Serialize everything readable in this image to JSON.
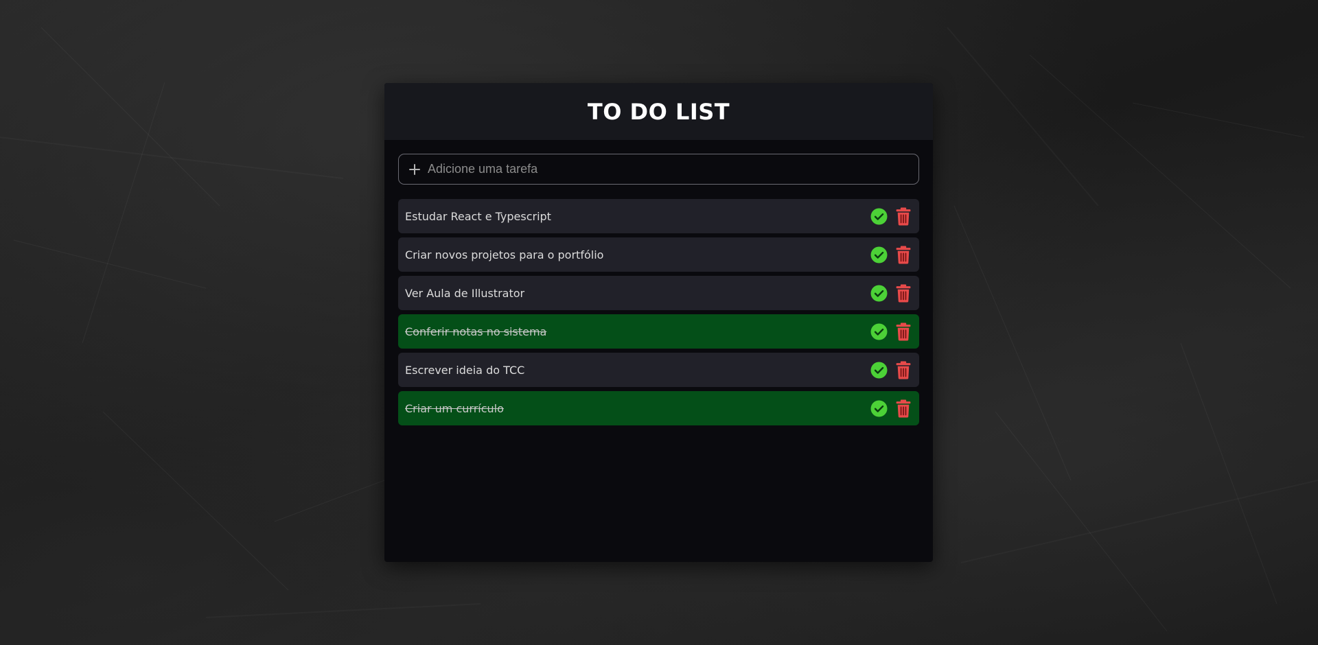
{
  "app": {
    "title": "TO DO LIST"
  },
  "add_task": {
    "placeholder": "Adicione uma tarefa",
    "value": "",
    "icon": "plus-icon"
  },
  "tasks": [
    {
      "text": "Estudar React e Typescript",
      "completed": false
    },
    {
      "text": "Criar novos projetos para o portfólio",
      "completed": false
    },
    {
      "text": "Ver Aula de Illustrator",
      "completed": false
    },
    {
      "text": "Conferir notas no sistema",
      "completed": true
    },
    {
      "text": "Escrever ideia do TCC",
      "completed": false
    },
    {
      "text": "Criar um currículo",
      "completed": true
    }
  ],
  "task_actions": {
    "complete_icon": "check-circle-icon",
    "delete_icon": "trash-icon"
  },
  "colors": {
    "header_bg": "#17181d",
    "panel_bg": "#0a0a0e",
    "task_bg": "#212129",
    "task_done_bg": "#044f18",
    "check_green": "#4cd137",
    "trash_red": "#e84a4a"
  }
}
